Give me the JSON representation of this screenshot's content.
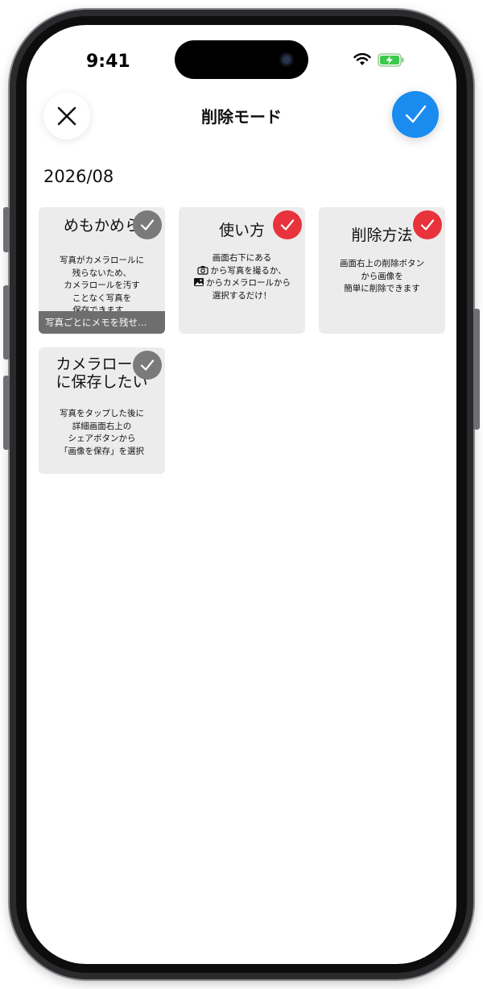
{
  "status_bar": {
    "time": "9:41"
  },
  "header": {
    "title": "削除モード",
    "close_icon": "close-icon",
    "confirm_icon": "checkmark-icon",
    "confirm_color": "#1a8cf0"
  },
  "section": {
    "date": "2026/08"
  },
  "cards": [
    {
      "title_lines": [
        "めもかめら"
      ],
      "body_lines": [
        "写真がカメラロールに",
        "残らないため、",
        "カメラロールを汚す",
        "ことなく写真を",
        "保存できます。"
      ],
      "caption": "写真ごとにメモを残せ…",
      "selected": false,
      "check_color": "#7a7a7a"
    },
    {
      "title_lines": [
        "使い方"
      ],
      "body_lines": [
        "画面右下にある",
        "から写真を撮るか、",
        "からカメラロールから",
        "選択するだけ！"
      ],
      "selected": true,
      "check_color": "#e8333c"
    },
    {
      "title_lines": [
        "削除方法"
      ],
      "body_lines": [
        "画面右上の削除ボタン",
        "から画像を",
        "簡単に削除できます"
      ],
      "selected": true,
      "check_color": "#e8333c"
    },
    {
      "title_lines": [
        "カメラロール",
        "に保存したい"
      ],
      "body_lines": [
        "写真をタップした後に",
        "詳細画面右上の",
        "シェアボタンから",
        "「画像を保存」を選択"
      ],
      "selected": false,
      "check_color": "#7a7a7a"
    }
  ]
}
